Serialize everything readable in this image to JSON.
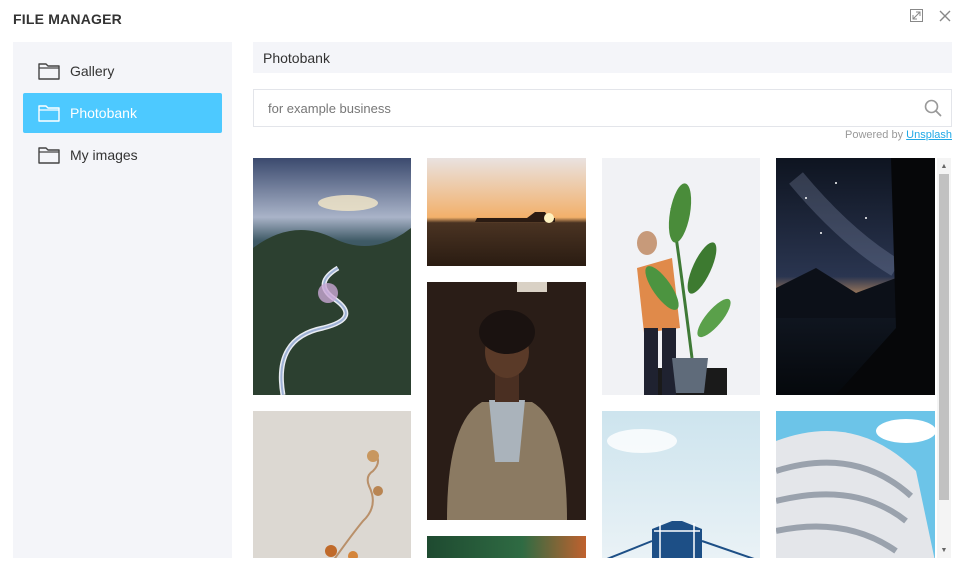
{
  "window": {
    "title": "FILE MANAGER",
    "expand_icon": "expand-icon",
    "close_icon": "close-icon"
  },
  "sidebar": {
    "items": [
      {
        "label": "Gallery",
        "icon": "folder-icon",
        "active": false
      },
      {
        "label": "Photobank",
        "icon": "folder-icon",
        "active": true
      },
      {
        "label": "My images",
        "icon": "folder-icon",
        "active": false
      }
    ]
  },
  "main": {
    "heading": "Photobank",
    "search": {
      "placeholder": "for example business",
      "value": "",
      "icon": "search-icon"
    },
    "powered_by": "Powered by",
    "powered_link": "Unsplash",
    "photos": [
      {
        "subject": "winding road through forested mountains at sunset"
      },
      {
        "subject": "car silhouette on beach at sunset"
      },
      {
        "subject": "man holding large potted plant"
      },
      {
        "subject": "milky way over lake at night"
      },
      {
        "subject": "dried flowers on pale background"
      },
      {
        "subject": "man with afro in jacket"
      },
      {
        "subject": "Ambassador Bridge sign against sky"
      },
      {
        "subject": "curved white modern building"
      },
      {
        "subject": "green and orange abstract"
      }
    ]
  },
  "colors": {
    "accent": "#4dc9ff",
    "panel": "#f4f5f9",
    "link": "#1fa8e6"
  }
}
